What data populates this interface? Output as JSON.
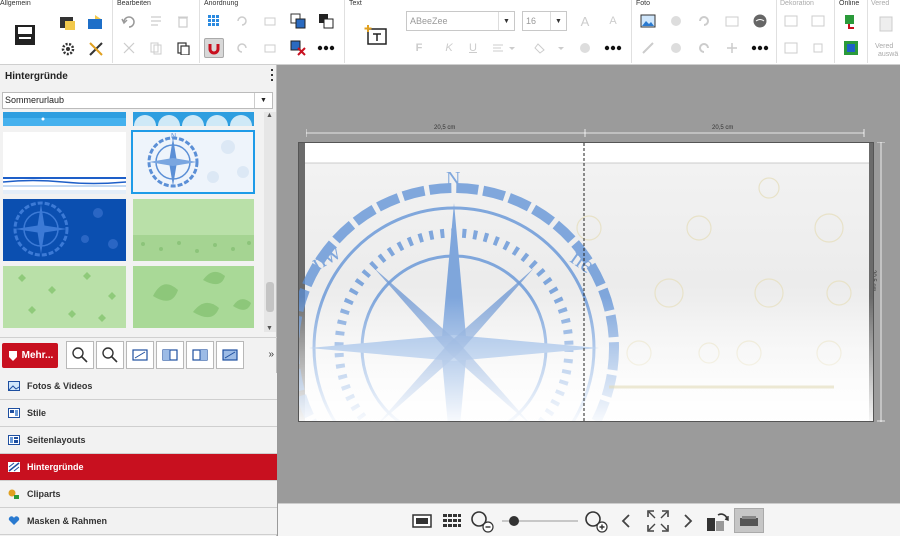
{
  "ribbon": {
    "groups": {
      "allgemein": "Allgemein",
      "bearbeiten": "Bearbeiten",
      "anordnung": "Anordnung",
      "text": "Text",
      "foto": "Foto",
      "dekoration": "Dekoration",
      "online": "Online",
      "veredelung": "Vered"
    },
    "font_name": "ABeeZee",
    "font_size": "16",
    "veredelung_label_top": "Vered",
    "veredelung_label_bottom": "auswä"
  },
  "sidebar": {
    "title": "Hintergründe",
    "category_select": "Sommerurlaub",
    "more_button": "Mehr...",
    "more_chevron": "»",
    "nav": [
      {
        "label": "Fotos & Videos",
        "icon": "photo-video-icon"
      },
      {
        "label": "Stile",
        "icon": "styles-icon"
      },
      {
        "label": "Seitenlayouts",
        "icon": "page-layouts-icon"
      },
      {
        "label": "Hintergründe",
        "icon": "backgrounds-icon",
        "active": true
      },
      {
        "label": "Cliparts",
        "icon": "cliparts-icon"
      },
      {
        "label": "Masken & Rahmen",
        "icon": "masks-frames-icon"
      }
    ]
  },
  "canvas": {
    "ruler_left": "20,5 cm",
    "ruler_right": "20,5 cm",
    "ruler_height": "20,5 cm"
  },
  "colors": {
    "accent_red": "#c8101f",
    "selection_blue": "#1e9be8",
    "compass_blue": "#5b8fd6"
  }
}
